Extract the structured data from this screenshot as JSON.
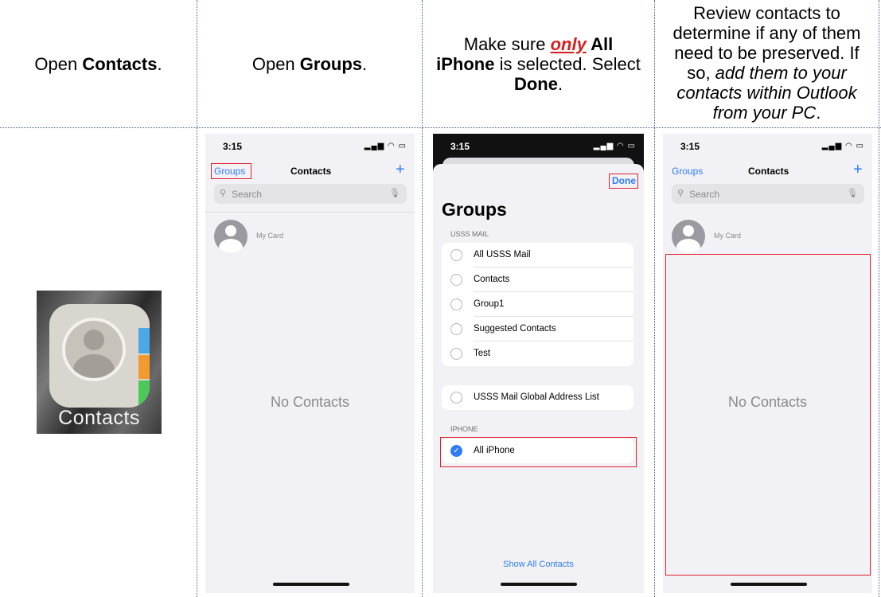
{
  "headers": {
    "col1": {
      "pre": "Open ",
      "bold": "Contacts",
      "post": "."
    },
    "col2": {
      "pre": "Open ",
      "bold": "Groups",
      "post": "."
    },
    "col3": {
      "t1": "Make sure ",
      "emph": "only",
      "b1": " All",
      "b2": "iPhone",
      "t2": " is selected. Select",
      "b3": "Done",
      "t3": "."
    },
    "col4": {
      "l1": "Review contacts to",
      "l2": "determine if any of them",
      "l3": "need to be preserved. If",
      "l4a": "so, ",
      "l4b": "add them to your",
      "l5": "contacts within Outlook",
      "l6a": "from your PC",
      "l6b": "."
    }
  },
  "app_icon": {
    "label": "Contacts",
    "icon": "contacts-app-icon"
  },
  "screen2": {
    "time": "3:15",
    "status": "▂▄▆ ◠ ▭",
    "nav_left": "Groups",
    "title": "Contacts",
    "plus": "+",
    "search_placeholder": "Search",
    "my_card": "My Card",
    "empty": "No Contacts"
  },
  "screen3": {
    "time": "3:15",
    "status": "▂▄▆ ◠ ▭",
    "done": "Done",
    "title": "Groups",
    "section1": "USSS MAIL",
    "items1": [
      "All USSS Mail",
      "Contacts",
      "Group1",
      "Suggested Contacts",
      "Test"
    ],
    "items2": [
      "USSS Mail Global Address List"
    ],
    "section2": "IPHONE",
    "iphone_item": "All iPhone",
    "show_all": "Show All Contacts"
  },
  "screen4": {
    "time": "3:15",
    "status": "▂▄▆ ◠ ▭",
    "nav_left": "Groups",
    "title": "Contacts",
    "plus": "+",
    "search_placeholder": "Search",
    "my_card": "My Card",
    "empty": "No Contacts"
  },
  "colors": {
    "accent": "#2f7cf6",
    "highlight": "#e0202a"
  }
}
